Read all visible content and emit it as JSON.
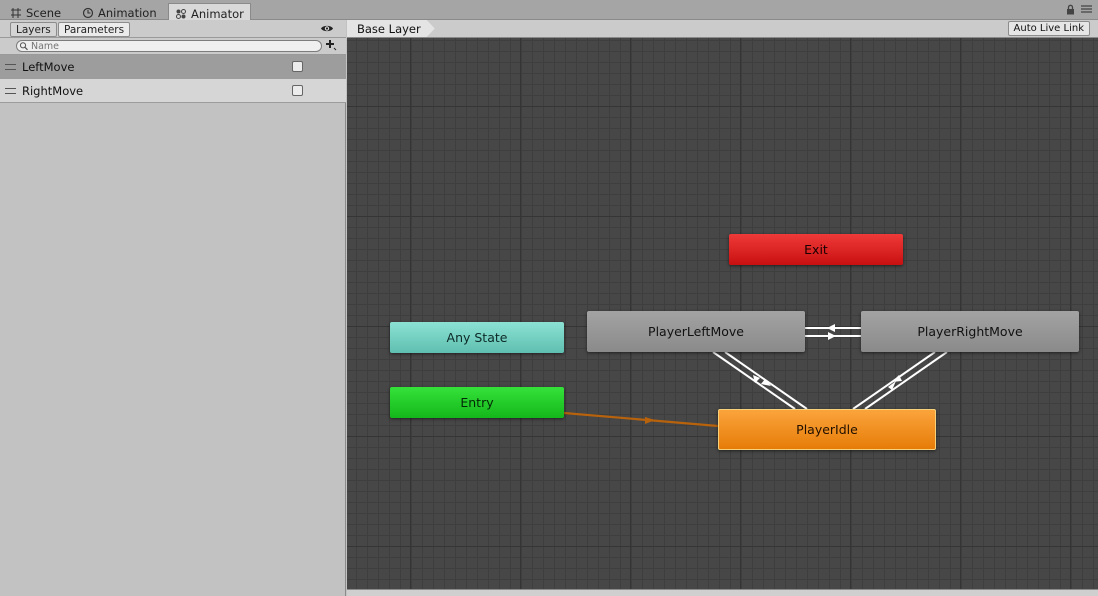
{
  "tabs": [
    {
      "label": "Scene",
      "icon": "grid-icon",
      "active": false
    },
    {
      "label": "Animation",
      "icon": "clock-icon",
      "active": false
    },
    {
      "label": "Animator",
      "icon": "animator-icon",
      "active": true
    }
  ],
  "left_panel": {
    "tabs": [
      {
        "label": "Layers",
        "active": false
      },
      {
        "label": "Parameters",
        "active": true
      }
    ],
    "search": {
      "placeholder": "Name",
      "value": ""
    },
    "parameters": [
      {
        "name": "LeftMove",
        "type": "bool",
        "value": false,
        "selected": true
      },
      {
        "name": "RightMove",
        "type": "bool",
        "value": false,
        "selected": false
      }
    ]
  },
  "graph_header": {
    "breadcrumb": "Base Layer",
    "auto_live_link_label": "Auto Live Link"
  },
  "states": {
    "exit": "Exit",
    "any_state": "Any State",
    "entry": "Entry",
    "player_left_move": "PlayerLeftMove",
    "player_right_move": "PlayerRightMove",
    "player_idle": "PlayerIdle"
  },
  "colors": {
    "exit": "#d81c1c",
    "any_state": "#74d1c3",
    "entry": "#22cc28",
    "default_state": "#ff9a1c",
    "state": "#979797",
    "entry_transition": "#b8620c",
    "transition": "#ffffff"
  }
}
